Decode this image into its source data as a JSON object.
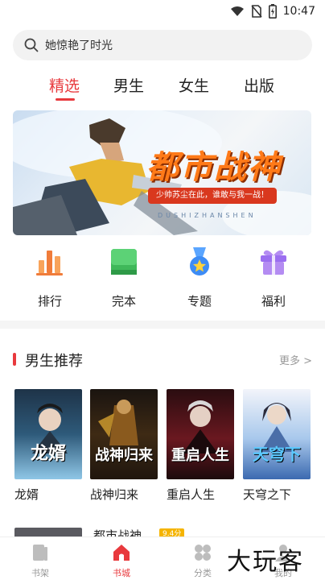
{
  "status_bar": {
    "time": "10:47",
    "icons": [
      "wifi-icon",
      "no-sim-icon",
      "battery-icon"
    ]
  },
  "search": {
    "placeholder": "她惊艳了时光"
  },
  "tabs": [
    {
      "label": "精选",
      "active": true
    },
    {
      "label": "男生",
      "active": false
    },
    {
      "label": "女生",
      "active": false
    },
    {
      "label": "出版",
      "active": false
    }
  ],
  "banner": {
    "title": "都市战神",
    "subtitle": "少帅苏尘在此，谁敢与我一战！",
    "pinyin": "DUSHIZHANSHEN"
  },
  "categories": [
    {
      "label": "排行",
      "icon": "ranking-icon"
    },
    {
      "label": "完本",
      "icon": "book-complete-icon"
    },
    {
      "label": "专题",
      "icon": "medal-icon"
    },
    {
      "label": "福利",
      "icon": "gift-icon"
    }
  ],
  "section": {
    "title": "男生推荐",
    "more": "更多 >"
  },
  "books": [
    {
      "title": "龙婿",
      "cover_title": "龙婿"
    },
    {
      "title": "战神归来",
      "cover_title": "战神归来"
    },
    {
      "title": "重启人生",
      "cover_title": "重启人生"
    },
    {
      "title": "天穹之下",
      "cover_title": "天穹下"
    }
  ],
  "next_item": {
    "title": "都市战神",
    "badge": "9.4分"
  },
  "bottom_nav": [
    {
      "label": "书架",
      "icon": "bookshelf-icon",
      "active": false
    },
    {
      "label": "书城",
      "icon": "bookstore-icon",
      "active": true
    },
    {
      "label": "分类",
      "icon": "category-icon",
      "active": false
    },
    {
      "label": "我的",
      "icon": "profile-icon",
      "active": false
    }
  ],
  "watermark": "大玩客",
  "colors": {
    "accent": "#e8393d",
    "banner_title": "#ff7a18"
  }
}
